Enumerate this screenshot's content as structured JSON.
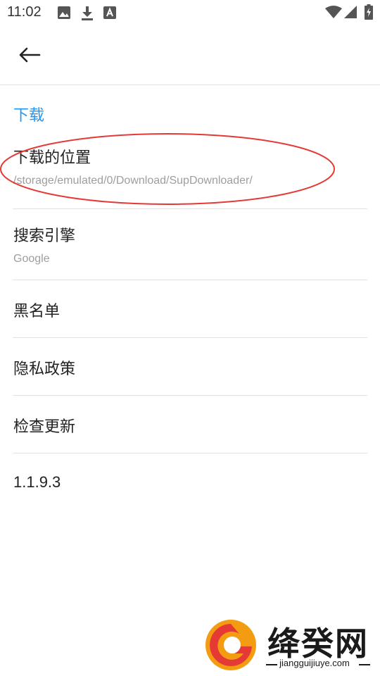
{
  "status_bar": {
    "time": "11:02",
    "left_icons": [
      "image-icon",
      "download-icon",
      "a-box-icon"
    ],
    "right_icons": [
      "wifi-icon",
      "cell-signal-icon",
      "battery-icon"
    ]
  },
  "toolbar": {
    "back_icon": "arrow-left-icon"
  },
  "section": {
    "title": "下载",
    "accent_color": "#2196f3"
  },
  "settings": [
    {
      "title": "下载的位置",
      "summary": "/storage/emulated/0/Download/SupDownloader/"
    },
    {
      "title": "搜索引擎",
      "summary": "Google"
    },
    {
      "title": "黑名单"
    },
    {
      "title": "隐私政策"
    },
    {
      "title": "检查更新"
    },
    {
      "title": "1.1.9.3"
    }
  ],
  "annotation": {
    "shape": "ellipse",
    "color": "#e53935"
  },
  "watermark": {
    "logo_text": "绛癸网",
    "url": "jiangguijiuye.com"
  }
}
